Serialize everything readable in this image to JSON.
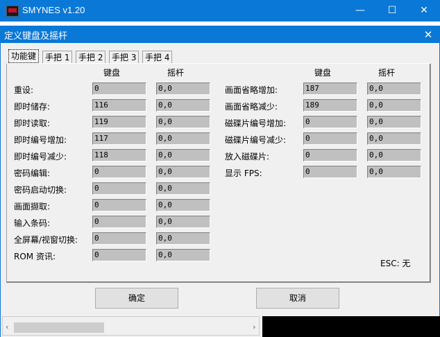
{
  "window": {
    "title": "SMYNES v1.20",
    "minimize": "—",
    "maximize": "☐",
    "close": "✕"
  },
  "dialog": {
    "title": "定义键盘及摇杆",
    "close": "✕",
    "tabs": [
      "功能键",
      "手把 1",
      "手把 2",
      "手把 3",
      "手把 4"
    ],
    "header_keyboard": "键盘",
    "header_joystick": "摇杆",
    "left_rows": [
      {
        "label": "重设:",
        "keyboard": "0",
        "joystick": "0,0"
      },
      {
        "label": "即时储存:",
        "keyboard": "116",
        "joystick": "0,0"
      },
      {
        "label": "即时读取:",
        "keyboard": "119",
        "joystick": "0,0"
      },
      {
        "label": "即时编号增加:",
        "keyboard": "117",
        "joystick": "0,0"
      },
      {
        "label": "即时编号减少:",
        "keyboard": "118",
        "joystick": "0,0"
      },
      {
        "label": "密码编辑:",
        "keyboard": "0",
        "joystick": "0,0"
      },
      {
        "label": "密码启动切换:",
        "keyboard": "0",
        "joystick": "0,0"
      },
      {
        "label": "画面撷取:",
        "keyboard": "0",
        "joystick": "0,0"
      },
      {
        "label": "输入条码:",
        "keyboard": "0",
        "joystick": "0,0"
      },
      {
        "label": "全屏幕/视窗切换:",
        "keyboard": "0",
        "joystick": "0,0"
      },
      {
        "label": "ROM 资讯:",
        "keyboard": "0",
        "joystick": "0,0"
      }
    ],
    "right_rows": [
      {
        "label": "画面省略增加:",
        "keyboard": "187",
        "joystick": "0,0"
      },
      {
        "label": "画面省略减少:",
        "keyboard": "189",
        "joystick": "0,0"
      },
      {
        "label": "磁碟片编号增加:",
        "keyboard": "0",
        "joystick": "0,0"
      },
      {
        "label": "磁碟片编号减少:",
        "keyboard": "0",
        "joystick": "0,0"
      },
      {
        "label": "放入磁碟片:",
        "keyboard": "0",
        "joystick": "0,0"
      },
      {
        "label": "显示 FPS:",
        "keyboard": "0",
        "joystick": "0,0"
      }
    ],
    "esc_note": "ESC: 无",
    "ok": "确定",
    "cancel": "取消"
  },
  "scroll": {
    "left_arrow": "‹",
    "right_arrow": "›"
  },
  "colors": {
    "titlebar": "#0a78d7",
    "field": "#c0c0c0"
  }
}
